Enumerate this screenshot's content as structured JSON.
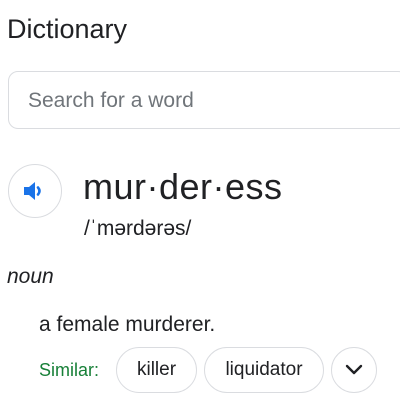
{
  "page": {
    "title": "Dictionary"
  },
  "search": {
    "placeholder": "Search for a word"
  },
  "entry": {
    "word": "mur·der·ess",
    "phonetic": "/ˈmərdərəs/",
    "part_of_speech": "noun",
    "definition": "a female murderer.",
    "similar_label": "Similar:",
    "similar": [
      "killer",
      "liquidator"
    ]
  },
  "icons": {
    "audio": "speaker-icon",
    "expand": "chevron-down-icon"
  },
  "colors": {
    "accent_blue": "#1a73e8",
    "similar_green": "#188038",
    "border": "#dadce0",
    "placeholder": "#70757a"
  }
}
